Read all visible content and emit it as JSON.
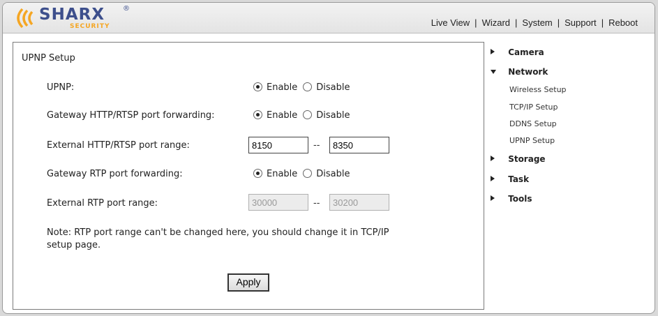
{
  "header": {
    "logo": {
      "word": "SHARX",
      "sub": "SECURITY",
      "reg": "®"
    },
    "nav": [
      "Live View",
      "Wizard",
      "System",
      "Support",
      "Reboot"
    ],
    "separator": "|"
  },
  "panel": {
    "title": "UPNP Setup",
    "upnp": {
      "label": "UPNP:",
      "enable": "Enable",
      "disable": "Disable",
      "selected": "Enable"
    },
    "http_forwarding": {
      "label": "Gateway HTTP/RTSP port forwarding:",
      "enable": "Enable",
      "disable": "Disable",
      "selected": "Enable"
    },
    "http_range": {
      "label": "External HTTP/RTSP port range:",
      "from": "8150",
      "to": "8350",
      "dash": "--"
    },
    "rtp_forwarding": {
      "label": "Gateway RTP port forwarding:",
      "enable": "Enable",
      "disable": "Disable",
      "selected": "Enable"
    },
    "rtp_range": {
      "label": "External RTP port range:",
      "from": "30000",
      "to": "30200",
      "dash": "--",
      "disabled": true
    },
    "note_line1": "Note: RTP port range can't be changed here, you should change it in TCP/IP",
    "note_line2": "setup page.",
    "apply_label": "Apply"
  },
  "sidebar": {
    "sections": [
      {
        "name": "Camera",
        "expanded": false
      },
      {
        "name": "Network",
        "expanded": true,
        "items": [
          "Wireless Setup",
          "TCP/IP Setup",
          "DDNS Setup",
          "UPNP Setup"
        ]
      },
      {
        "name": "Storage",
        "expanded": false
      },
      {
        "name": "Task",
        "expanded": false
      },
      {
        "name": "Tools",
        "expanded": false
      }
    ]
  },
  "colors": {
    "logo_blue": "#3d4f8c",
    "logo_orange": "#f5a623",
    "background": "#d9d9d9"
  },
  "icons": {
    "collapsed": "triangle-right-icon",
    "expanded": "triangle-down-icon"
  }
}
